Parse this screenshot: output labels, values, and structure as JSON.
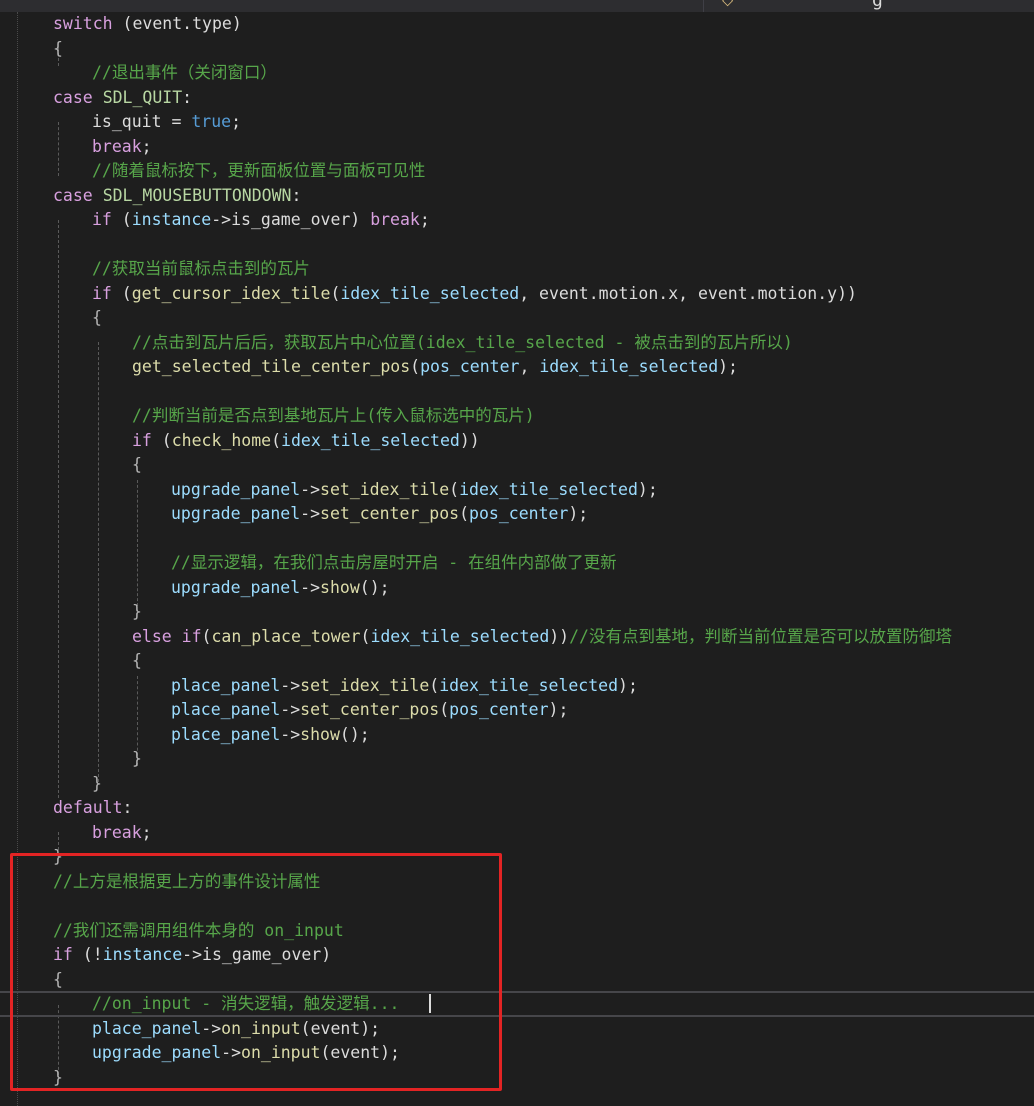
{
  "editor": {
    "tab_partial_glyph": "g",
    "lines": [
      {
        "indent": 53,
        "tokens": [
          [
            "kw2",
            "switch"
          ],
          [
            "pl",
            " (event.type)"
          ]
        ]
      },
      {
        "indent": 53,
        "tokens": [
          [
            "pu",
            "{"
          ]
        ]
      },
      {
        "indent": 92,
        "tokens": [
          [
            "cm",
            "//退出事件（关闭窗口）"
          ]
        ]
      },
      {
        "indent": 53,
        "tokens": [
          [
            "kw2",
            "case"
          ],
          [
            "pl",
            " "
          ],
          [
            "en",
            "SDL_QUIT"
          ],
          [
            "pl",
            ":"
          ]
        ]
      },
      {
        "indent": 92,
        "tokens": [
          [
            "pl",
            "is_quit = "
          ],
          [
            "kw",
            "true"
          ],
          [
            "pl",
            ";"
          ]
        ]
      },
      {
        "indent": 92,
        "tokens": [
          [
            "kw2",
            "break"
          ],
          [
            "pl",
            ";"
          ]
        ]
      },
      {
        "indent": 92,
        "tokens": [
          [
            "cm",
            "//随着鼠标按下，更新面板位置与面板可见性"
          ]
        ]
      },
      {
        "indent": 53,
        "tokens": [
          [
            "kw2",
            "case"
          ],
          [
            "pl",
            " "
          ],
          [
            "en",
            "SDL_MOUSEBUTTONDOWN"
          ],
          [
            "pl",
            ":"
          ]
        ]
      },
      {
        "indent": 92,
        "tokens": [
          [
            "kw2",
            "if"
          ],
          [
            "pl",
            " ("
          ],
          [
            "id",
            "instance"
          ],
          [
            "pl",
            "->is_game_over) "
          ],
          [
            "kw2",
            "break"
          ],
          [
            "pl",
            ";"
          ]
        ]
      },
      {
        "indent": 92,
        "tokens": []
      },
      {
        "indent": 92,
        "tokens": [
          [
            "cm",
            "//获取当前鼠标点击到的瓦片"
          ]
        ]
      },
      {
        "indent": 92,
        "tokens": [
          [
            "kw2",
            "if"
          ],
          [
            "pl",
            " ("
          ],
          [
            "fn",
            "get_cursor_idex_tile"
          ],
          [
            "pl",
            "("
          ],
          [
            "id",
            "idex_tile_selected"
          ],
          [
            "pl",
            ", event.motion.x, event.motion.y))"
          ]
        ]
      },
      {
        "indent": 92,
        "tokens": [
          [
            "pu",
            "{"
          ]
        ]
      },
      {
        "indent": 132,
        "tokens": [
          [
            "cm",
            "//点击到瓦片后后，获取瓦片中心位置(idex_tile_selected - 被点击到的瓦片所以)"
          ]
        ]
      },
      {
        "indent": 132,
        "tokens": [
          [
            "fn",
            "get_selected_tile_center_pos"
          ],
          [
            "pl",
            "("
          ],
          [
            "id",
            "pos_center"
          ],
          [
            "pl",
            ", "
          ],
          [
            "id",
            "idex_tile_selected"
          ],
          [
            "pl",
            ");"
          ]
        ]
      },
      {
        "indent": 132,
        "tokens": []
      },
      {
        "indent": 132,
        "tokens": [
          [
            "cm",
            "//判断当前是否点到基地瓦片上(传入鼠标选中的瓦片)"
          ]
        ]
      },
      {
        "indent": 132,
        "tokens": [
          [
            "kw2",
            "if"
          ],
          [
            "pl",
            " ("
          ],
          [
            "fn",
            "check_home"
          ],
          [
            "pl",
            "("
          ],
          [
            "id",
            "idex_tile_selected"
          ],
          [
            "pl",
            "))"
          ]
        ]
      },
      {
        "indent": 132,
        "tokens": [
          [
            "pu",
            "{"
          ]
        ]
      },
      {
        "indent": 171,
        "tokens": [
          [
            "id",
            "upgrade_panel"
          ],
          [
            "pl",
            "->"
          ],
          [
            "fn",
            "set_idex_tile"
          ],
          [
            "pl",
            "("
          ],
          [
            "id",
            "idex_tile_selected"
          ],
          [
            "pl",
            ");"
          ]
        ]
      },
      {
        "indent": 171,
        "tokens": [
          [
            "id",
            "upgrade_panel"
          ],
          [
            "pl",
            "->"
          ],
          [
            "fn",
            "set_center_pos"
          ],
          [
            "pl",
            "("
          ],
          [
            "id",
            "pos_center"
          ],
          [
            "pl",
            ");"
          ]
        ]
      },
      {
        "indent": 171,
        "tokens": []
      },
      {
        "indent": 171,
        "tokens": [
          [
            "cm",
            "//显示逻辑，在我们点击房屋时开启 - 在组件内部做了更新"
          ]
        ]
      },
      {
        "indent": 171,
        "tokens": [
          [
            "id",
            "upgrade_panel"
          ],
          [
            "pl",
            "->"
          ],
          [
            "fn",
            "show"
          ],
          [
            "pl",
            "();"
          ]
        ]
      },
      {
        "indent": 132,
        "tokens": [
          [
            "pu",
            "}"
          ]
        ]
      },
      {
        "indent": 132,
        "tokens": [
          [
            "kw2",
            "else if"
          ],
          [
            "pl",
            "("
          ],
          [
            "fn",
            "can_place_tower"
          ],
          [
            "pl",
            "("
          ],
          [
            "id",
            "idex_tile_selected"
          ],
          [
            "pl",
            "))"
          ],
          [
            "cm",
            "//没有点到基地，判断当前位置是否可以放置防御塔"
          ]
        ]
      },
      {
        "indent": 132,
        "tokens": [
          [
            "pu",
            "{"
          ]
        ]
      },
      {
        "indent": 171,
        "tokens": [
          [
            "id",
            "place_panel"
          ],
          [
            "pl",
            "->"
          ],
          [
            "fn",
            "set_idex_tile"
          ],
          [
            "pl",
            "("
          ],
          [
            "id",
            "idex_tile_selected"
          ],
          [
            "pl",
            ");"
          ]
        ]
      },
      {
        "indent": 171,
        "tokens": [
          [
            "id",
            "place_panel"
          ],
          [
            "pl",
            "->"
          ],
          [
            "fn",
            "set_center_pos"
          ],
          [
            "pl",
            "("
          ],
          [
            "id",
            "pos_center"
          ],
          [
            "pl",
            ");"
          ]
        ]
      },
      {
        "indent": 171,
        "tokens": [
          [
            "id",
            "place_panel"
          ],
          [
            "pl",
            "->"
          ],
          [
            "fn",
            "show"
          ],
          [
            "pl",
            "();"
          ]
        ]
      },
      {
        "indent": 132,
        "tokens": [
          [
            "pu",
            "}"
          ]
        ]
      },
      {
        "indent": 92,
        "tokens": [
          [
            "pu",
            "}"
          ]
        ]
      },
      {
        "indent": 53,
        "tokens": [
          [
            "kw2",
            "default"
          ],
          [
            "pl",
            ":"
          ]
        ]
      },
      {
        "indent": 92,
        "tokens": [
          [
            "kw2",
            "break"
          ],
          [
            "pl",
            ";"
          ]
        ]
      },
      {
        "indent": 53,
        "tokens": [
          [
            "pu",
            "}"
          ]
        ]
      },
      {
        "indent": 53,
        "tokens": [
          [
            "cm",
            "//上方是根据更上方的事件设计属性"
          ]
        ]
      },
      {
        "indent": 53,
        "tokens": []
      },
      {
        "indent": 53,
        "tokens": [
          [
            "cm",
            "//我们还需调用组件本身的 on_input"
          ]
        ]
      },
      {
        "indent": 53,
        "tokens": [
          [
            "kw2",
            "if"
          ],
          [
            "pl",
            " (!"
          ],
          [
            "id",
            "instance"
          ],
          [
            "pl",
            "->is_game_over)"
          ]
        ]
      },
      {
        "indent": 53,
        "tokens": [
          [
            "pu",
            "{"
          ]
        ]
      },
      {
        "indent": 92,
        "tokens": [
          [
            "cm",
            "//on_input - 消失逻辑，触发逻辑..."
          ]
        ]
      },
      {
        "indent": 92,
        "tokens": [
          [
            "id",
            "place_panel"
          ],
          [
            "pl",
            "->"
          ],
          [
            "fn",
            "on_input"
          ],
          [
            "pl",
            "(event);"
          ]
        ]
      },
      {
        "indent": 92,
        "tokens": [
          [
            "id",
            "upgrade_panel"
          ],
          [
            "pl",
            "->"
          ],
          [
            "fn",
            "on_input"
          ],
          [
            "pl",
            "(event);"
          ]
        ]
      },
      {
        "indent": 53,
        "tokens": [
          [
            "pu",
            "}"
          ]
        ]
      }
    ]
  },
  "colors": {
    "background": "#1e1e1e",
    "highlight_box": "#e32424",
    "comment": "#57a64a",
    "keyword": "#d8a0df",
    "function": "#dcdcaa",
    "identifier": "#9cdcfe"
  }
}
